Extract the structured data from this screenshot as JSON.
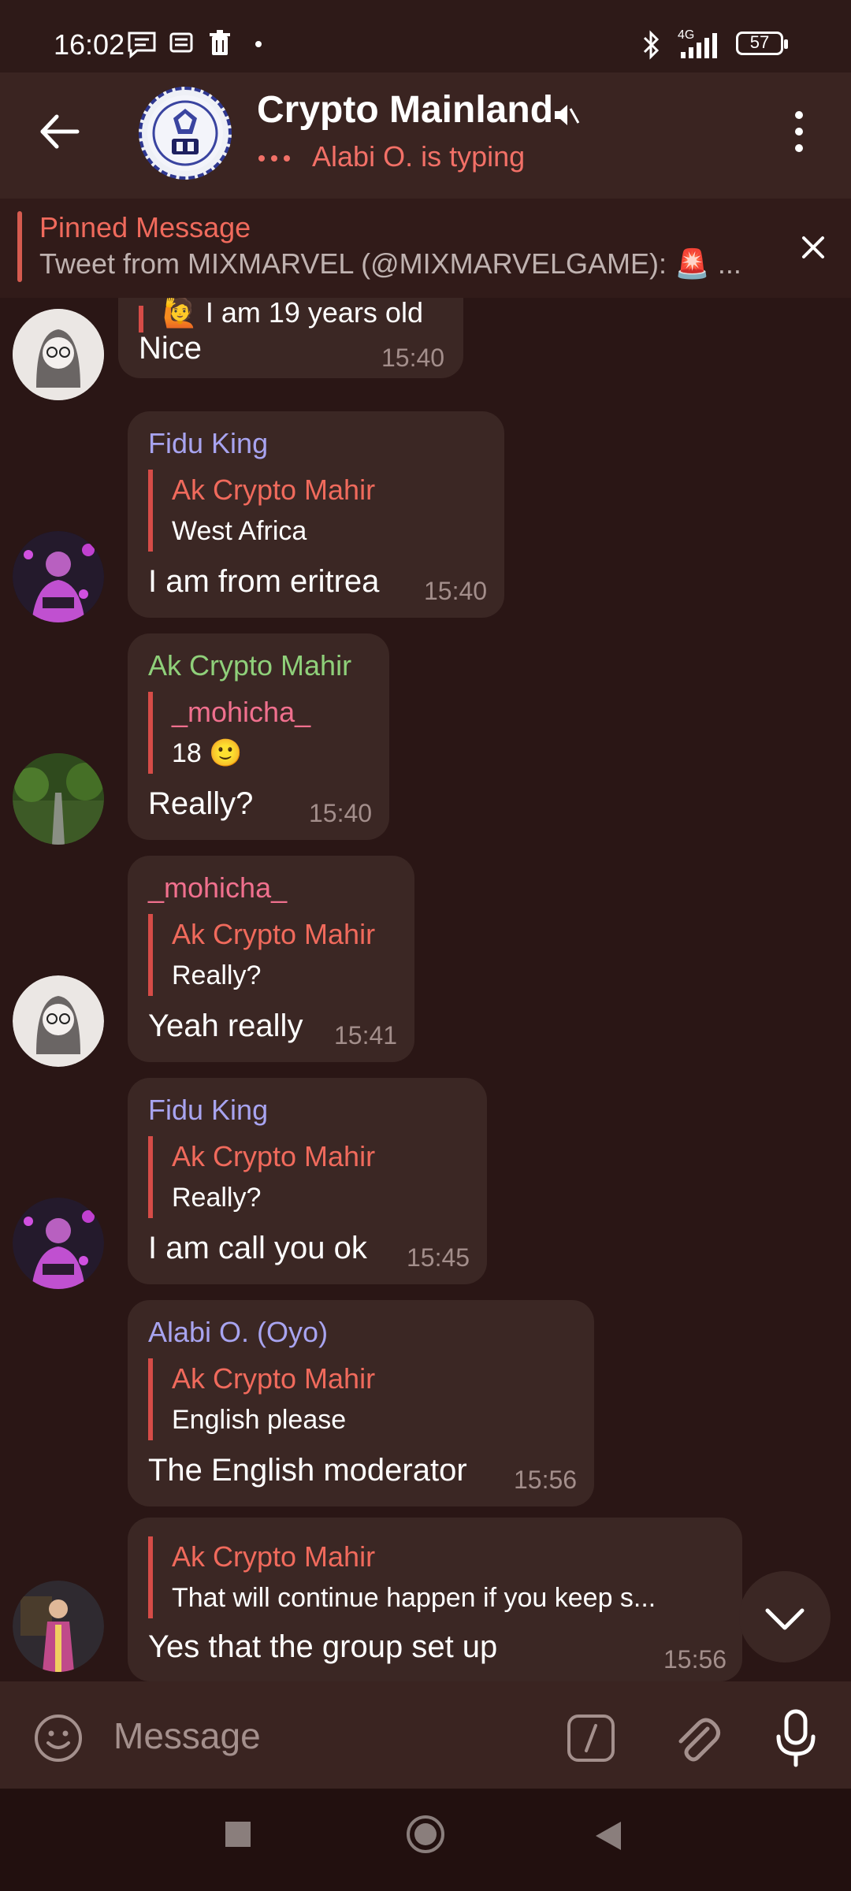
{
  "status_bar": {
    "time": "16:02",
    "network": "4G",
    "battery": "57",
    "icons": [
      "message-notification-icon",
      "news-icon",
      "trash-icon",
      "dot-icon",
      "bluetooth-icon",
      "signal-icon",
      "battery-icon"
    ]
  },
  "header": {
    "title": "Crypto Mainland",
    "typing_status": "Alabi O. is typing",
    "muted": true
  },
  "pinned": {
    "title": "Pinned Message",
    "text": "Tweet from MIXMARVEL (@MIXMARVELGAME): 🚨 ..."
  },
  "messages": [
    {
      "reply_text": "🙋 I am 19 years old",
      "text": "Nice",
      "time": "15:40"
    },
    {
      "sender": "Fidu King",
      "reply_to": "Ak Crypto Mahir",
      "reply_text": "West Africa",
      "text": "I am from eritrea",
      "time": "15:40"
    },
    {
      "sender": "Ak Crypto Mahir",
      "reply_to": "_mohicha_",
      "reply_text": "18 🙂",
      "text": "Really?",
      "time": "15:40"
    },
    {
      "sender": "_mohicha_",
      "reply_to": "Ak Crypto Mahir",
      "reply_text": "Really?",
      "text": "Yeah really",
      "time": "15:41"
    },
    {
      "sender": "Fidu King",
      "reply_to": "Ak Crypto Mahir",
      "reply_text": "Really?",
      "text": "I am call you ok",
      "time": "15:45"
    },
    {
      "sender": "Alabi O. (Oyo)",
      "reply_to": "Ak Crypto Mahir",
      "reply_text": "English please",
      "text": "The English moderator",
      "time": "15:56"
    },
    {
      "reply_to": "Ak Crypto Mahir",
      "reply_text": "That will continue happen if you keep s...",
      "text": "Yes that the group set up",
      "time": "15:56"
    }
  ],
  "input": {
    "placeholder": "Message"
  },
  "colors": {
    "background": "#2a1615",
    "header": "#3a2421",
    "bubble": "#3b2724",
    "accent_red": "#f06a5c",
    "sender_fidu": "#a8a4f0",
    "sender_mahir": "#8fd07a",
    "sender_mohicha": "#f0708e",
    "sender_alabi": "#a8a4f0",
    "time": "#a38e8b"
  }
}
